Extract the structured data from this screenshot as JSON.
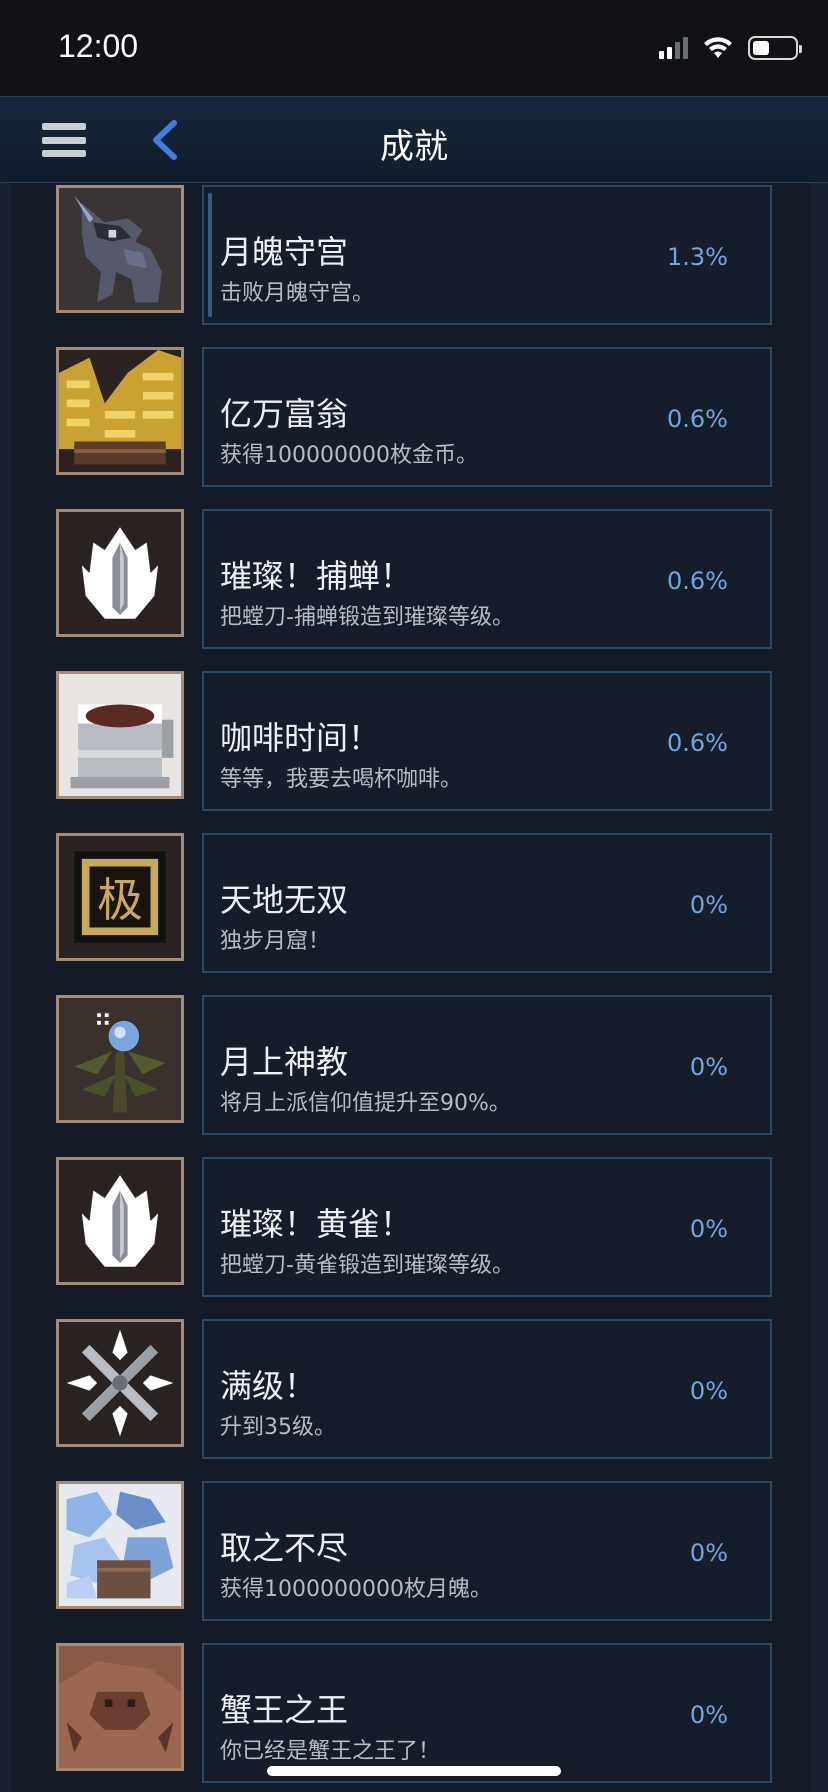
{
  "status_bar": {
    "time": "12:00"
  },
  "nav": {
    "title": "成就"
  },
  "achievements": [
    {
      "title": "月魄守宫",
      "desc": "击败月魄守宫。",
      "pct": "1.3%",
      "icon": "moon-gecko-icon"
    },
    {
      "title": "亿万富翁",
      "desc": "获得100000000枚金币。",
      "pct": "0.6%",
      "icon": "gold-coins-icon"
    },
    {
      "title": "璀璨！捕蝉！",
      "desc": "把螳刀-捕蝉锻造到璀璨等级。",
      "pct": "0.6%",
      "icon": "blade-flame-icon"
    },
    {
      "title": "咖啡时间！",
      "desc": "等等，我要去喝杯咖啡。",
      "pct": "0.6%",
      "icon": "coffee-cup-icon"
    },
    {
      "title": "天地无双",
      "desc": "独步月窟！",
      "pct": "0%",
      "icon": "ji-plaque-icon",
      "plaque_char": "极"
    },
    {
      "title": "月上神教",
      "desc": "将月上派信仰值提升至90%。",
      "pct": "0%",
      "icon": "faith-plant-icon"
    },
    {
      "title": "璀璨！黄雀！",
      "desc": "把螳刀-黄雀锻造到璀璨等级。",
      "pct": "0%",
      "icon": "blade-flame-icon"
    },
    {
      "title": "满级！",
      "desc": "升到35级。",
      "pct": "0%",
      "icon": "crossed-swords-icon"
    },
    {
      "title": "取之不尽",
      "desc": "获得1000000000枚月魄。",
      "pct": "0%",
      "icon": "crystal-pile-icon"
    },
    {
      "title": "蟹王之王",
      "desc": "你已经是蟹王之王了！",
      "pct": "0%",
      "icon": "crab-king-icon"
    }
  ]
}
